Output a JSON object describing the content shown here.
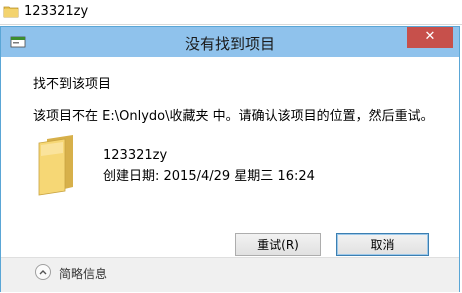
{
  "window": {
    "strip_title": "123321zy",
    "dialog_title": "没有找到项目",
    "close_glyph": "✕"
  },
  "content": {
    "heading": "找不到该项目",
    "message": "该项目不在 E:\\Onlydo\\收藏夹 中。请确认该项目的位置，然后重试。",
    "item_name": "123321zy",
    "item_created": "创建日期: 2015/4/29 星期三 16:24"
  },
  "buttons": {
    "retry": "重试(R)",
    "cancel": "取消"
  },
  "footer": {
    "details_label": "简略信息"
  },
  "icons": {
    "strip": "folder-icon",
    "title": "app-icon",
    "item": "folder-icon",
    "footer": "chevron-up-icon"
  }
}
